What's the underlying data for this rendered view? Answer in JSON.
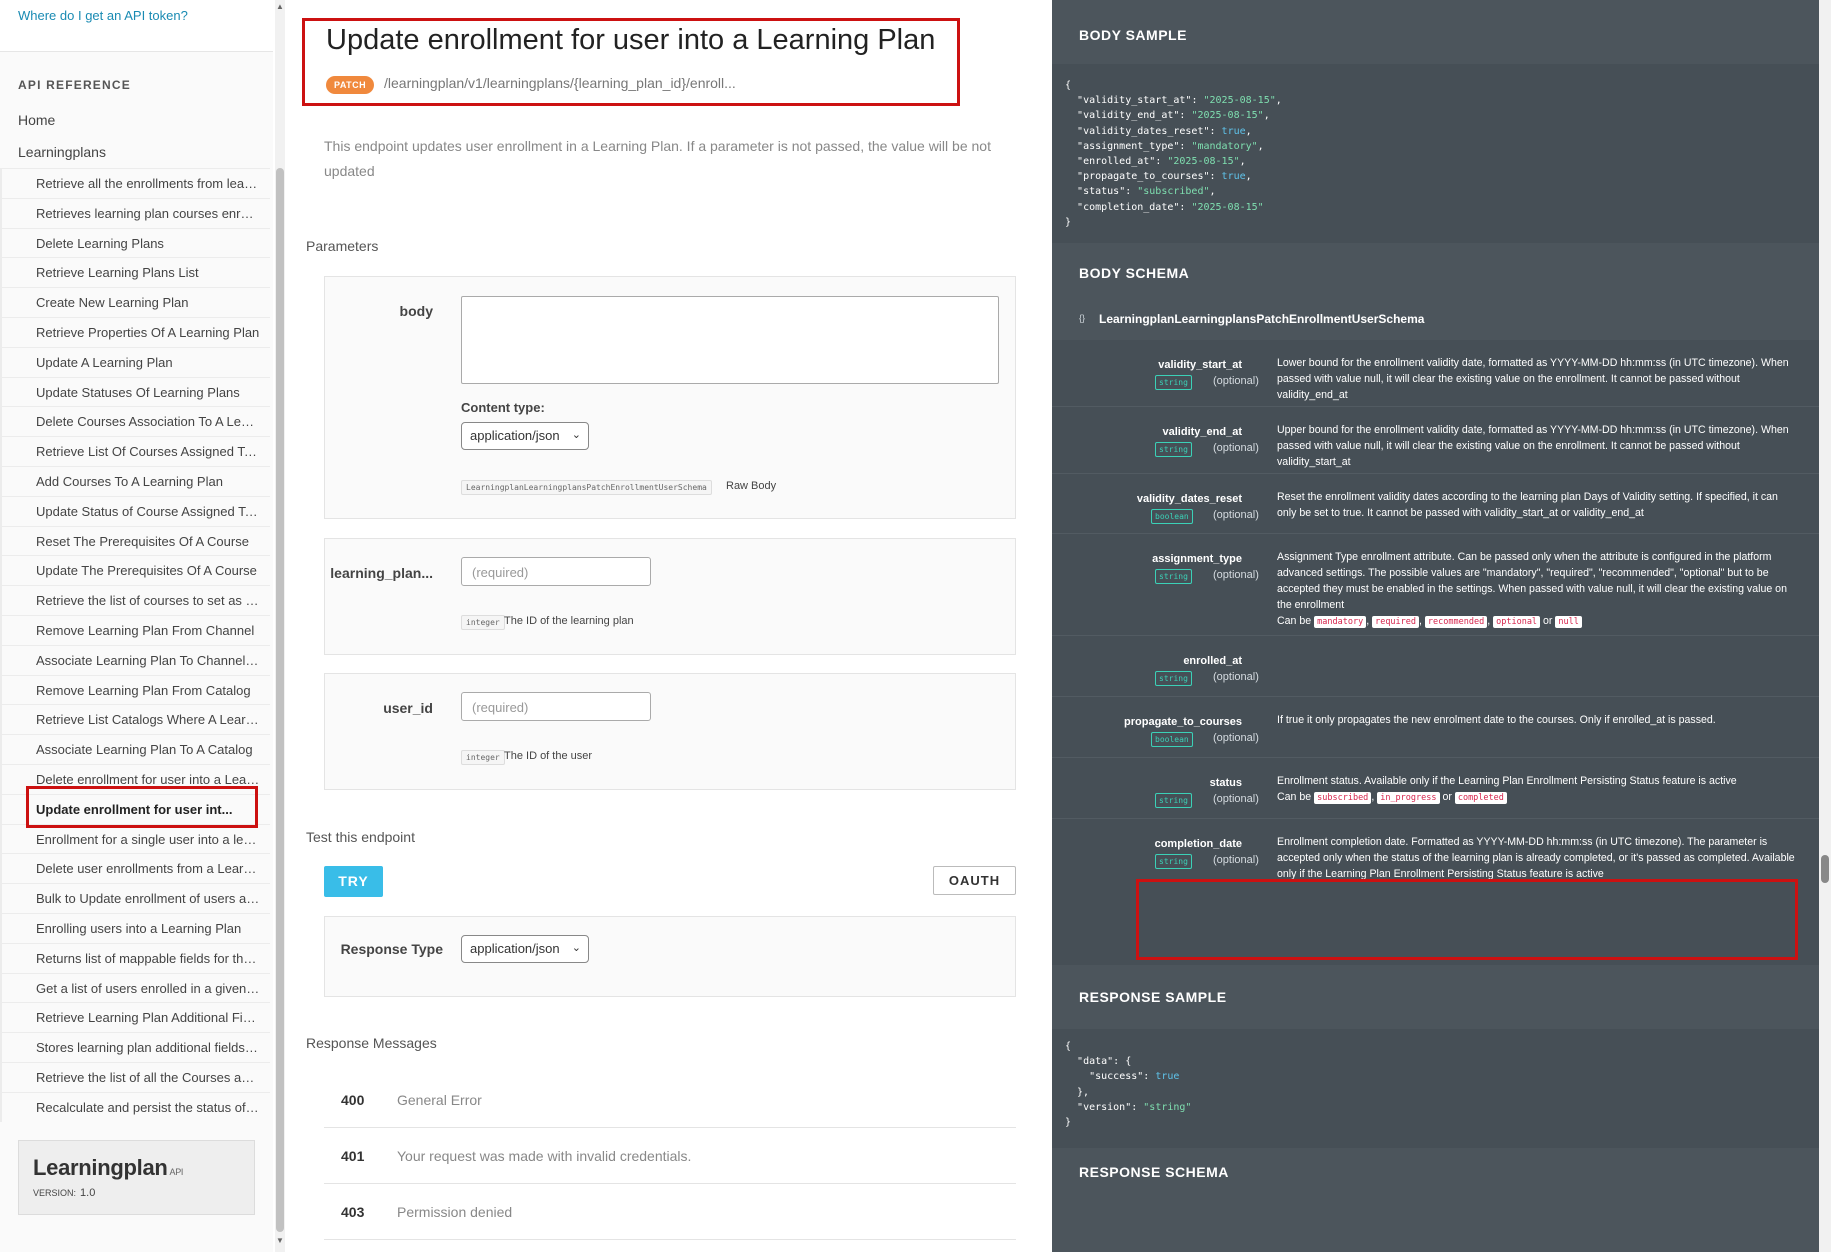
{
  "sidebar": {
    "help_link": "Where do I get an API token?",
    "api_reference_heading": "API REFERENCE",
    "top_items": [
      "Home",
      "Learningplans"
    ],
    "items": [
      "Retrieve all the enrollments from learning plans",
      "Retrieves learning plan courses enrollments",
      "Delete Learning Plans",
      "Retrieve Learning Plans List",
      "Create New Learning Plan",
      "Retrieve Properties Of A Learning Plan",
      "Update A Learning Plan",
      "Update Statuses Of Learning Plans",
      "Delete Courses Association To A Learning Plan",
      "Retrieve List Of Courses Assigned To A Learning Plan",
      "Add Courses To A Learning Plan",
      "Update Status of Course Assigned To A Learning Plan",
      "Reset The Prerequisites Of A Course",
      "Update The Prerequisites Of A Course",
      "Retrieve the list of courses to set as prerequisites",
      "Remove Learning Plan From Channel",
      "Associate Learning Plan To Channel List",
      "Remove Learning Plan From Catalog",
      "Retrieve List Catalogs Where A Learning Plan",
      "Associate Learning Plan To A Catalog",
      "Delete enrollment for user into a Learning Plan",
      "Update enrollment for user int...",
      "Enrollment for a single user into a learning plan",
      "Delete user enrollments from a Learning Plan",
      "Bulk to Update enrollment of users as...",
      "Enrolling users into a Learning Plan",
      "Returns list of mappable fields for the learning plan",
      "Get a list of users enrolled in a given learning plan",
      "Retrieve Learning Plan Additional Fields",
      "Stores learning plan additional fields values",
      "Retrieve the list of all the Courses assigned",
      "Recalculate and persist the status of a learning plan"
    ],
    "active_index": 21,
    "api_card": {
      "name": "Learningplan",
      "api_tag": "API",
      "version_label": "VERSION:",
      "version": "1.0"
    }
  },
  "main": {
    "title": "Update enrollment for user into a Learning Plan",
    "method": "PATCH",
    "path": "/learningplan/v1/learningplans/{learning_plan_id}/enroll...",
    "description": "This endpoint updates user enrollment in a Learning Plan. If a parameter is not passed, the value will be not updated",
    "parameters_heading": "Parameters",
    "body_param": {
      "label": "body",
      "content_type_label": "Content type:",
      "content_type_value": "application/json",
      "schema_tag": "LearningplanLearningplansPatchEnrollmentUserSchema",
      "raw_body_label": "Raw Body"
    },
    "learning_plan_param": {
      "label": "learning_plan...",
      "placeholder": "(required)",
      "type": "integer",
      "desc": "The ID of the learning plan"
    },
    "user_id_param": {
      "label": "user_id",
      "placeholder": "(required)",
      "type": "integer",
      "desc": "The ID of the user"
    },
    "test_heading": "Test this endpoint",
    "try_label": "TRY",
    "oauth_label": "OAUTH",
    "response_type_label": "Response Type",
    "response_type_value": "application/json",
    "response_messages_heading": "Response Messages",
    "responses": [
      {
        "code": "400",
        "message": "General Error"
      },
      {
        "code": "401",
        "message": "Your request was made with invalid credentials."
      },
      {
        "code": "403",
        "message": "Permission denied"
      }
    ]
  },
  "right": {
    "body_sample_heading": "BODY SAMPLE",
    "body_sample": [
      {
        "key": "validity_start_at",
        "value": "\"2025-08-15\"",
        "kind": "str"
      },
      {
        "key": "validity_end_at",
        "value": "\"2025-08-15\"",
        "kind": "str"
      },
      {
        "key": "validity_dates_reset",
        "value": "true",
        "kind": "bool"
      },
      {
        "key": "assignment_type",
        "value": "\"mandatory\"",
        "kind": "str"
      },
      {
        "key": "enrolled_at",
        "value": "\"2025-08-15\"",
        "kind": "str"
      },
      {
        "key": "propagate_to_courses",
        "value": "true",
        "kind": "bool"
      },
      {
        "key": "status",
        "value": "\"subscribed\"",
        "kind": "str"
      },
      {
        "key": "completion_date",
        "value": "\"2025-08-15\"",
        "kind": "str"
      }
    ],
    "body_schema_heading": "BODY SCHEMA",
    "schema_brace": "{}",
    "schema_name": "LearningplanLearningplansPatchEnrollmentUserSchema",
    "optional_label": "(optional)",
    "can_be_label": "Can be",
    "or_label": "or",
    "fields": [
      {
        "name": "validity_start_at",
        "type": "string",
        "desc": "Lower bound for the enrollment validity date, formatted as YYYY-MM-DD hh:mm:ss (in UTC timezone). When passed with value null, it will clear the existing value on the enrollment. It cannot be passed without validity_end_at"
      },
      {
        "name": "validity_end_at",
        "type": "string",
        "desc": "Upper bound for the enrollment validity date, formatted as YYYY-MM-DD hh:mm:ss (in UTC timezone). When passed with value null, it will clear the existing value on the enrollment. It cannot be passed without validity_start_at"
      },
      {
        "name": "validity_dates_reset",
        "type": "boolean",
        "desc": "Reset the enrollment validity dates according to the learning plan Days of Validity setting. If specified, it can only be set to true. It cannot be passed with validity_start_at or validity_end_at"
      },
      {
        "name": "assignment_type",
        "type": "string",
        "desc": "Assignment Type enrollment attribute. Can be passed only when the attribute is configured in the platform advanced settings. The possible values are \"mandatory\", \"required\", \"recommended\", \"optional\" but to be accepted they must be enabled in the settings. When passed with value null, it will clear the existing value on the enrollment",
        "enum": [
          "mandatory",
          "required",
          "recommended",
          "optional",
          "null"
        ]
      },
      {
        "name": "enrolled_at",
        "type": "string",
        "desc": ""
      },
      {
        "name": "propagate_to_courses",
        "type": "boolean",
        "desc": "If true it only propagates the new enrolment date to the courses. Only if enrolled_at is passed."
      },
      {
        "name": "status",
        "type": "string",
        "desc": "Enrollment status. Available only if the Learning Plan Enrollment Persisting Status feature is active",
        "enum": [
          "subscribed",
          "in_progress",
          "completed"
        ]
      },
      {
        "name": "completion_date",
        "type": "string",
        "desc": "Enrollment completion date. Formatted as YYYY-MM-DD hh:mm:ss (in UTC timezone). The parameter is accepted only when the status of the learning plan is already completed, or it's passed as completed. Available only if the Learning Plan Enrollment Persisting Status feature is active"
      }
    ],
    "response_sample_heading": "RESPONSE SAMPLE",
    "response_sample": {
      "data_key": "data",
      "success_key": "success",
      "success_value": "true",
      "version_key": "version",
      "version_value": "\"string\""
    },
    "response_schema_heading": "RESPONSE SCHEMA"
  }
}
